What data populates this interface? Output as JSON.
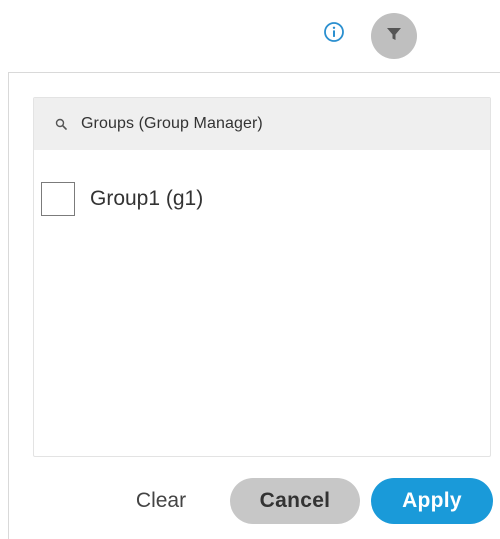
{
  "toolbar": {
    "info_icon": "info-icon",
    "filter_icon": "filter-icon"
  },
  "filter_panel": {
    "search": {
      "icon": "search-icon",
      "label": "Groups (Group Manager)"
    },
    "items": [
      {
        "label": "Group1 (g1)",
        "checked": false
      }
    ]
  },
  "footer": {
    "clear_label": "Clear",
    "cancel_label": "Cancel",
    "apply_label": "Apply"
  },
  "colors": {
    "accent": "#1a9ad9",
    "info_icon": "#2a8fcf",
    "muted_button": "#c7c7c7"
  }
}
